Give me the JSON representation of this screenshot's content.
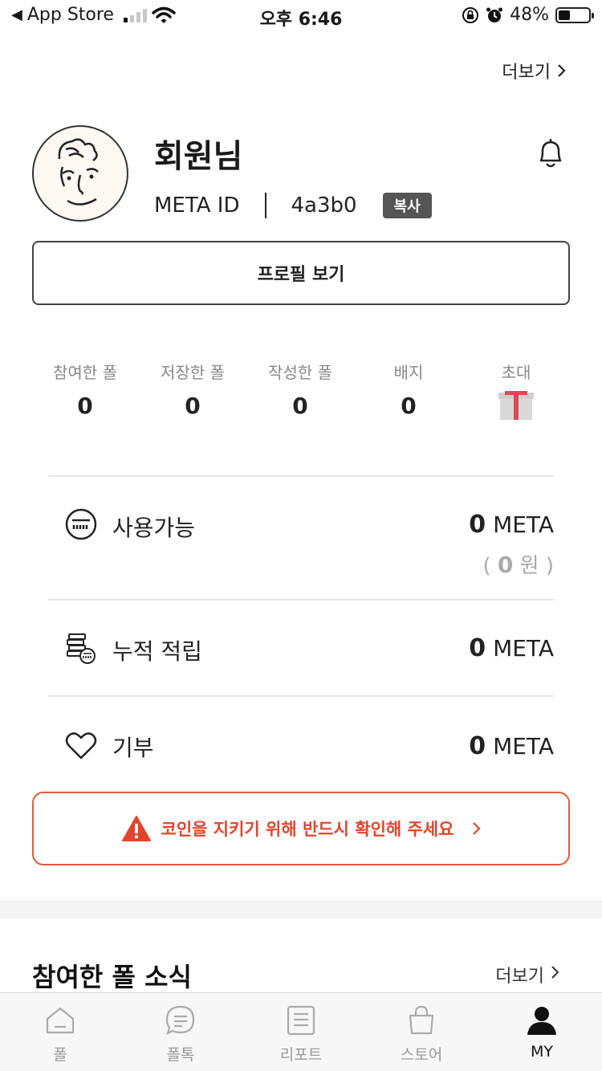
{
  "status_bar": {
    "back_app": "App Store",
    "time": "오후 6:46",
    "battery": "48%",
    "battery_level": 0.48
  },
  "header": {
    "more_label": "더보기"
  },
  "profile": {
    "name": "회원님",
    "id_label": "META ID",
    "id_value": "4a3b0",
    "copy_label": "복사",
    "view_profile_label": "프로필 보기"
  },
  "stats": [
    {
      "label": "참여한 폴",
      "value": "0"
    },
    {
      "label": "저장한 폴",
      "value": "0"
    },
    {
      "label": "작성한 폴",
      "value": "0"
    },
    {
      "label": "배지",
      "value": "0"
    },
    {
      "label": "초대",
      "icon": "gift-icon"
    }
  ],
  "wallet": {
    "available": {
      "label": "사용가능",
      "amount": "0",
      "unit": "META",
      "krw_open": "( ",
      "krw_amount": "0",
      "krw_unit": " 원 )"
    },
    "accumulated": {
      "label": "누적 적립",
      "amount": "0",
      "unit": "META"
    },
    "donation": {
      "label": "기부",
      "amount": "0",
      "unit": "META"
    }
  },
  "warning": {
    "text": "코인을 지키기 위해 반드시 확인해 주세요",
    "color": "#e0452c"
  },
  "news": {
    "title": "참여한 폴 소식",
    "more_label": "더보기"
  },
  "tabbar": [
    {
      "label": "폴",
      "icon": "home-icon"
    },
    {
      "label": "폴톡",
      "icon": "chat-icon"
    },
    {
      "label": "리포트",
      "icon": "report-icon"
    },
    {
      "label": "스토어",
      "icon": "bag-icon"
    },
    {
      "label": "MY",
      "icon": "person-icon",
      "active": true
    }
  ]
}
